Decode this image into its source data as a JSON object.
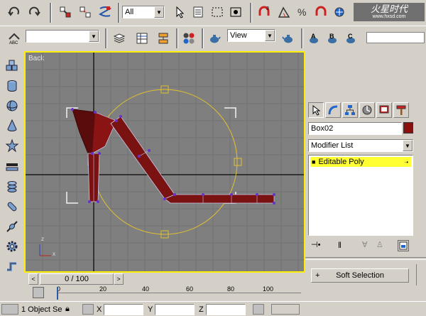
{
  "toolbar": {
    "selection_filter": "All",
    "named_selection": "",
    "ref_coord_system": "View"
  },
  "viewport": {
    "label": "Back",
    "axis_x": "x",
    "axis_z": "z"
  },
  "command_panel": {
    "object_name": "Box02",
    "object_color": "#8a0f0f",
    "modifier_list_label": "Modifier List",
    "stack": [
      {
        "label": "Editable Poly"
      }
    ],
    "rollout_soft_selection": "Soft Selection",
    "rollout_toggle": "+"
  },
  "timeline": {
    "frame_counter": "0 / 100",
    "ticks": [
      "0",
      "20",
      "40",
      "60",
      "80",
      "100"
    ]
  },
  "status": {
    "selection_info": "1 Object Se",
    "x_label": "X",
    "y_label": "Y",
    "z_label": "Z"
  },
  "watermark": {
    "text": "火星时代",
    "url": "www.hxsd.com"
  },
  "colors": {
    "viewport_bg": "#7f7f7f",
    "active_border": "#ffee00",
    "modifier_highlight": "#ffff33",
    "model_fill": "#7a1212",
    "gizmo": "#e0c030"
  }
}
